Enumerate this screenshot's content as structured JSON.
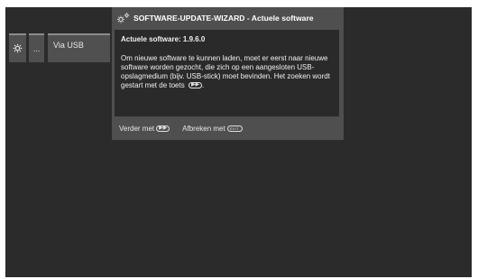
{
  "menu": {
    "items": [
      {
        "icon": "gear-icon"
      },
      {
        "label": "..."
      },
      {
        "label": "Via USB"
      }
    ]
  },
  "dialog": {
    "icon": "gears-icon",
    "title": "SOFTWARE-UPDATE-WIZARD - Actuele software",
    "version_line": "Actuele software: 1.9.6.0",
    "message": "Om nieuwe software te kunnen laden, moet er eerst naar nieuwe software worden gezocht, die zich op een aangesloten USB-opslagmedium (bijv. USB-stick) moet bevinden. Het zoeken wordt gestart met de toets",
    "message_end": ".",
    "footer": {
      "continue_label": "Verder met",
      "continue_key_icon": "fast-forward-key-icon",
      "cancel_label": "Afbreken met",
      "cancel_key_icon": "exit-key-icon"
    }
  }
}
